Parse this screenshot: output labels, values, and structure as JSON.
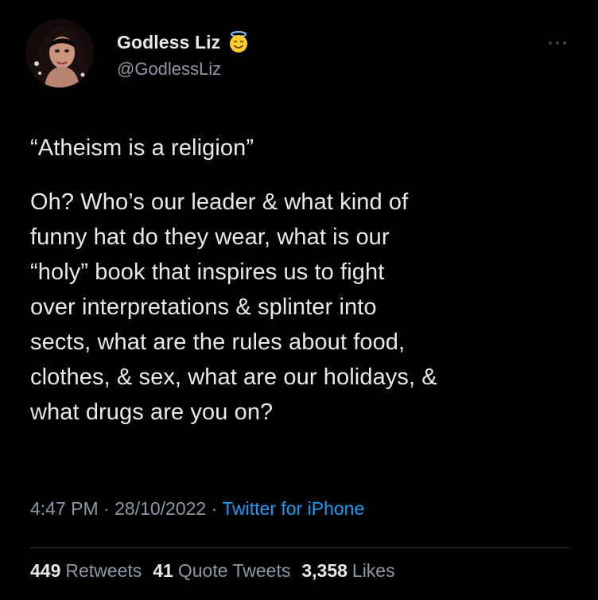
{
  "author": {
    "display_name": "Godless Liz",
    "handle": "@GodlessLiz",
    "badge_icon": "smiling-face-with-halo-icon",
    "avatar_icon": "profile-photo-avatar"
  },
  "tweet": {
    "lines": [
      "“Atheism is a religion”",
      "Oh? Who’s our leader & what kind of",
      "funny hat do they wear, what is our",
      "“holy” book that inspires us to fight",
      "over interpretations & splinter into",
      "sects, what are the rules about food,",
      "clothes, & sex, what are our holidays, &",
      "what drugs are you on?"
    ]
  },
  "meta": {
    "time": "4:47 PM",
    "separator": "·",
    "date": "28/10/2022",
    "source": "Twitter for iPhone"
  },
  "stats": {
    "retweets_count": "449",
    "retweets_label": "Retweets",
    "quote_count": "41",
    "quote_label": "Quote Tweets",
    "likes_count": "3,358",
    "likes_label": "Likes"
  },
  "menu": {
    "more_icon": "more-horizontal-icon"
  },
  "colors": {
    "background": "#000000",
    "text": "#e7e9ea",
    "secondary": "#8b98a5",
    "link": "#1d9bf0",
    "divider": "#2f3336"
  }
}
